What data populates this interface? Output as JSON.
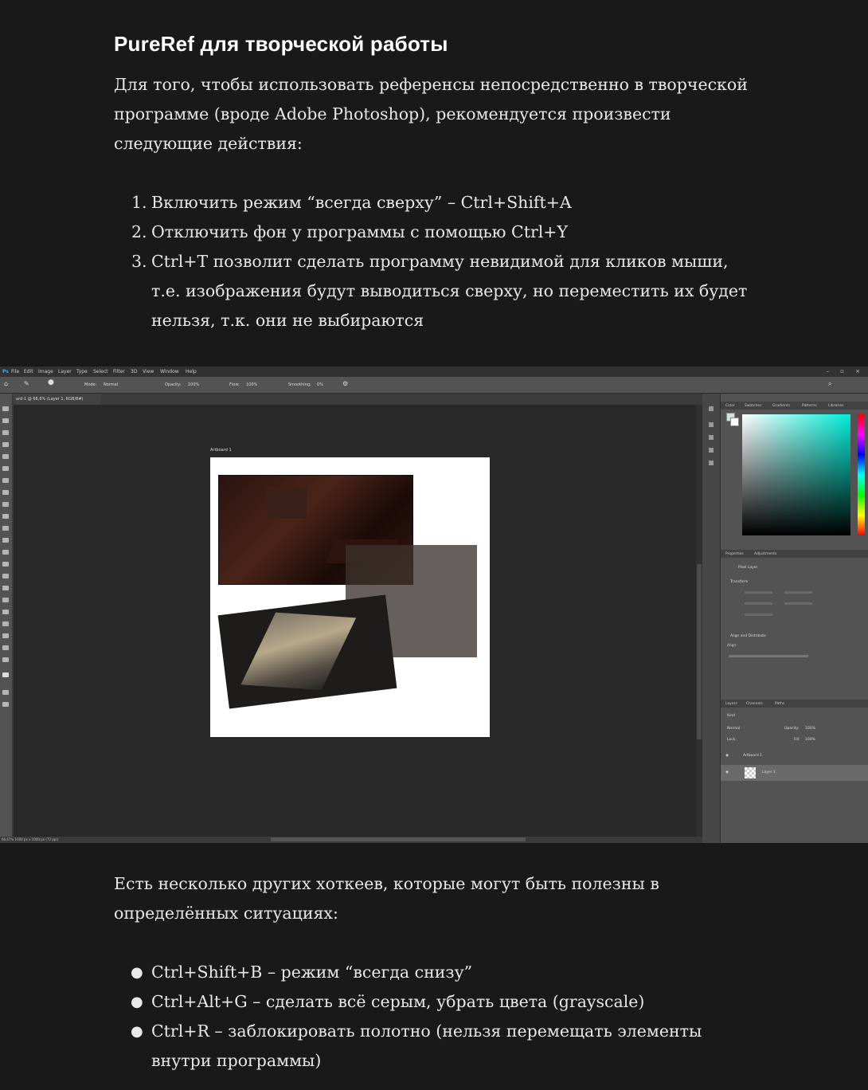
{
  "heading": "PureRef для творческой работы",
  "intro": [
    "Для того, чтобы использовать референсы непосредственно в творческой",
    "программе (вроде Adobe Photoshop), рекомендуется произвести",
    "следующие действия:"
  ],
  "steps": [
    {
      "num": "1.",
      "lines": [
        "Включить режим “всегда сверху” – Ctrl+Shift+A"
      ]
    },
    {
      "num": "2.",
      "lines": [
        "Отключить фон у программы с помощью Ctrl+Y"
      ]
    },
    {
      "num": "3.",
      "lines": [
        "Ctrl+T позволит сделать программу невидимой для кликов мыши,",
        "т.е. изображения будут выводиться сверху, но переместить их будет",
        "нельзя, т.к. они не выбираются"
      ]
    }
  ],
  "screenshot": {
    "menu": [
      "File",
      "Edit",
      "Image",
      "Layer",
      "Type",
      "Select",
      "Filter",
      "3D",
      "View",
      "Window",
      "Help"
    ],
    "window_buttons": "– ▫ ×",
    "options": [
      "Mode:",
      "Normal",
      "Opacity:",
      "100%",
      "Flow:",
      "100%",
      "Smoothing:",
      "0%"
    ],
    "doc_tab": "ard-1 @ 66,6% (Layer 1, RGB/8#)",
    "artboard_label": "Artboard 1",
    "status": "66,67%   1000 px x 1000 px (72 ppi)",
    "color_tabs": [
      "Color",
      "Swatches",
      "Gradients",
      "Patterns",
      "Libraries"
    ],
    "properties_tabs": [
      "Properties",
      "Adjustments"
    ],
    "properties_lines": [
      "Pixel Layer",
      "Transform",
      "Align and Distribute",
      "Align:"
    ],
    "layers_tabs": [
      "Layers",
      "Channels",
      "Paths"
    ],
    "layers_controls": [
      "Kind",
      "Normal",
      "Opacity:",
      "100%",
      "Lock:",
      "Fill:",
      "100%"
    ],
    "layers": [
      "Artboard 1",
      "Layer 1"
    ]
  },
  "outro": [
    "Есть несколько других хоткеев, которые могут быть полезны в",
    "определённых ситуациях:"
  ],
  "bullets": [
    {
      "lines": [
        "Ctrl+Shift+B – режим “всегда снизу”"
      ]
    },
    {
      "lines": [
        "Ctrl+Alt+G – сделать всё серым, убрать цвета (grayscale)"
      ]
    },
    {
      "lines": [
        "Ctrl+R – заблокировать полотно (нельзя перемещать элементы",
        "внутри программы)"
      ]
    }
  ],
  "colors": {
    "background": "#191919",
    "text": "#e8e8e8",
    "heading": "#ffffff"
  }
}
